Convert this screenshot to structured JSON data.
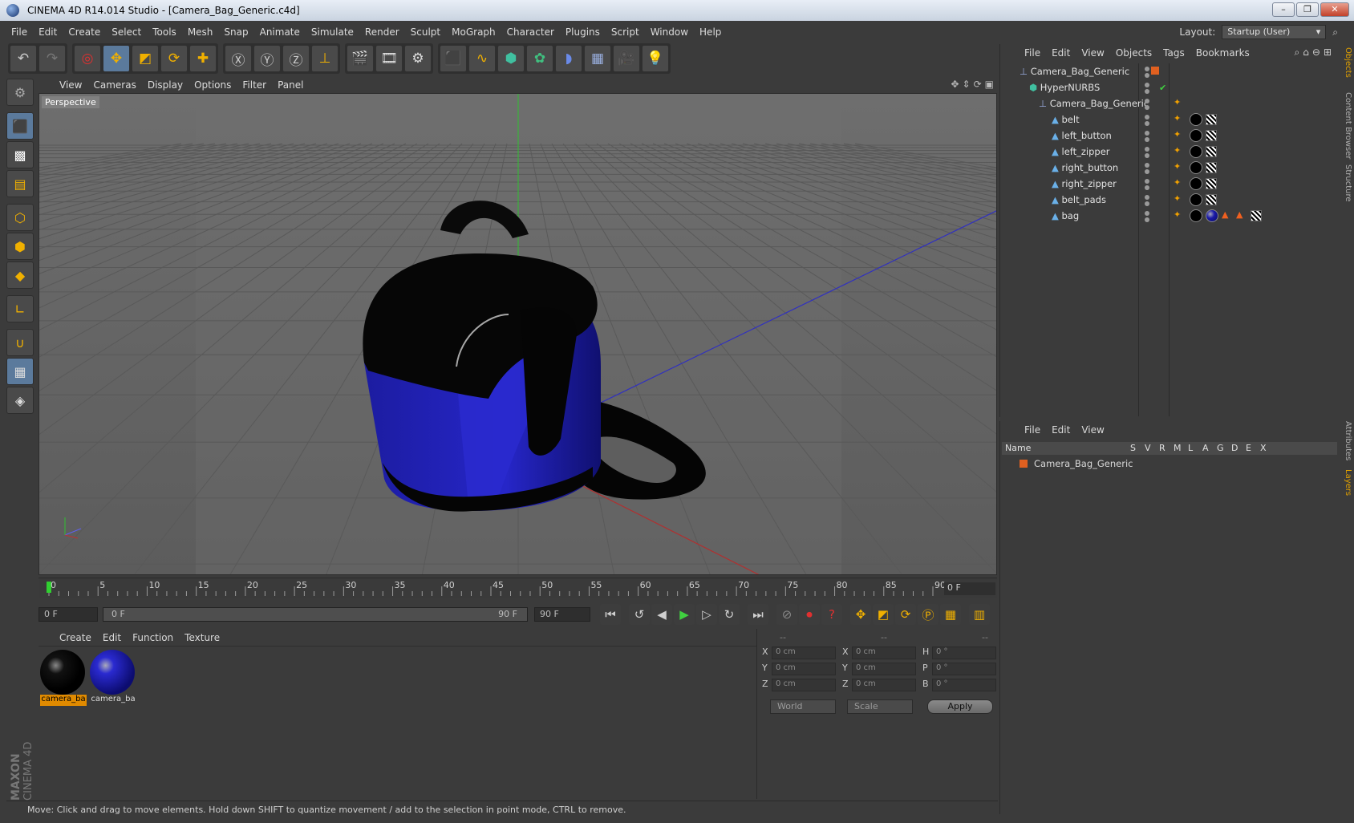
{
  "window": {
    "title": "CINEMA 4D R14.014 Studio - [Camera_Bag_Generic.c4d]",
    "min": "–",
    "restore": "❐",
    "close": "✕"
  },
  "menu": [
    "File",
    "Edit",
    "Create",
    "Select",
    "Tools",
    "Mesh",
    "Snap",
    "Animate",
    "Simulate",
    "Render",
    "Sculpt",
    "MoGraph",
    "Character",
    "Plugins",
    "Script",
    "Window",
    "Help"
  ],
  "layout": {
    "label": "Layout:",
    "value": "Startup (User)"
  },
  "viewport": {
    "menu": [
      "View",
      "Cameras",
      "Display",
      "Options",
      "Filter",
      "Panel"
    ],
    "label": "Perspective"
  },
  "timeline": {
    "ticks": [
      "0",
      "5",
      "10",
      "15",
      "20",
      "25",
      "30",
      "35",
      "40",
      "45",
      "50",
      "55",
      "60",
      "65",
      "70",
      "75",
      "80",
      "85",
      "90"
    ],
    "frame_right": "0 F",
    "start_field": "0 F",
    "slider_left": "0 F",
    "slider_right": "90 F",
    "end_field": "90 F"
  },
  "material_menu": [
    "Create",
    "Edit",
    "Function",
    "Texture"
  ],
  "materials": [
    {
      "label": "camera_ba",
      "color": "#000000",
      "selected": true
    },
    {
      "label": "camera_ba",
      "color": "#1a1aa8",
      "selected": false
    }
  ],
  "coords": {
    "headers": [
      "--",
      "--",
      "--"
    ],
    "rows": [
      {
        "a": "X",
        "av": "0 cm",
        "b": "X",
        "bv": "0 cm",
        "c": "H",
        "cv": "0 °"
      },
      {
        "a": "Y",
        "av": "0 cm",
        "b": "Y",
        "bv": "0 cm",
        "c": "P",
        "cv": "0 °"
      },
      {
        "a": "Z",
        "av": "0 cm",
        "b": "Z",
        "bv": "0 cm",
        "c": "B",
        "cv": "0 °"
      }
    ],
    "world": "World",
    "scale": "Scale",
    "apply": "Apply"
  },
  "status": "Move: Click and drag to move elements. Hold down SHIFT to quantize movement / add to the selection in point mode, CTRL to remove.",
  "object_manager": {
    "menu": [
      "File",
      "Edit",
      "View",
      "Objects",
      "Tags",
      "Bookmarks"
    ],
    "objects": [
      {
        "name": "Camera_Bag_Generic",
        "indent": 0
      },
      {
        "name": "HyperNURBS",
        "indent": 1
      },
      {
        "name": "Camera_Bag_Generic",
        "indent": 2
      },
      {
        "name": "belt",
        "indent": 3
      },
      {
        "name": "left_button",
        "indent": 3
      },
      {
        "name": "left_zipper",
        "indent": 3
      },
      {
        "name": "right_button",
        "indent": 3
      },
      {
        "name": "right_zipper",
        "indent": 3
      },
      {
        "name": "belt_pads",
        "indent": 3
      },
      {
        "name": "bag",
        "indent": 3
      }
    ],
    "check": "✔"
  },
  "layer_manager": {
    "menu": [
      "File",
      "Edit",
      "View"
    ],
    "columns": [
      "Name",
      "S",
      "V",
      "R",
      "M",
      "L",
      "A",
      "G",
      "D",
      "E",
      "X"
    ],
    "layers": [
      {
        "name": "Camera_Bag_Generic",
        "color": "#e06020"
      }
    ]
  },
  "side_tabs": [
    "Objects",
    "Content Browser",
    "Structure",
    "Attributes",
    "Layers"
  ],
  "brand": {
    "maxon": "MAXON",
    "c4d": "CINEMA 4D"
  },
  "colors": {
    "accent": "#f0b000",
    "selection": "#e08a00",
    "bag_blue": "#1a1aa8",
    "axis_x": "#c03030",
    "axis_y": "#30c030",
    "axis_z": "#3030c0"
  }
}
